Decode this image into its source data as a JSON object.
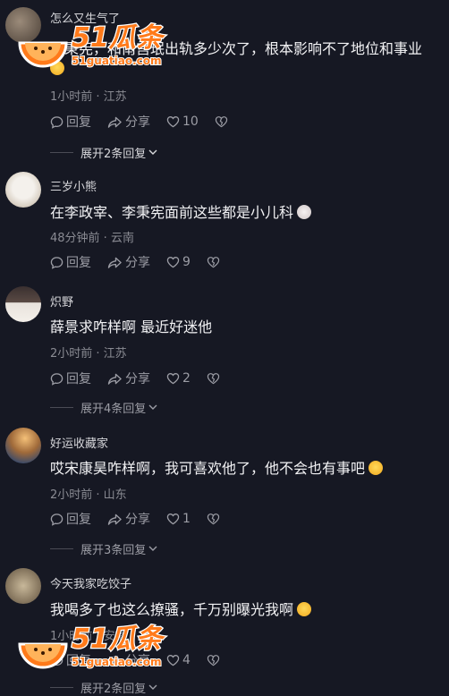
{
  "comments": [
    {
      "username": "怎么又生气了",
      "text": "李秉宪，和南宫珉出轨多少次了，根本影响不了地位和事业",
      "emoji": "grinning-sweat-emoji",
      "time_location": "1小时前 · 江苏",
      "reply_label": "回复",
      "share_label": "分享",
      "likes": "10",
      "expand_label": "展开2条回复"
    },
    {
      "username": "三岁小熊",
      "text": "在李政宰、李秉宪面前这些都是小儿科",
      "emoji": "cat-face-emoji",
      "time_location": "48分钟前 · 云南",
      "reply_label": "回复",
      "share_label": "分享",
      "likes": "9"
    },
    {
      "username": "炽野",
      "text": "薛景求咋样啊 最近好迷他",
      "time_location": "2小时前 · 江苏",
      "reply_label": "回复",
      "share_label": "分享",
      "likes": "2",
      "expand_label": "展开4条回复"
    },
    {
      "username": "好运收藏家",
      "text": "哎宋康昊咋样啊，我可喜欢他了，他不会也有事吧",
      "emoji": "smiling-emoji",
      "time_location": "2小时前 · 山东",
      "reply_label": "回复",
      "share_label": "分享",
      "likes": "1",
      "expand_label": "展开3条回复"
    },
    {
      "username": "今天我家吃饺子",
      "text": "我喝多了也这么撩骚，千万别曝光我啊",
      "emoji": "crying-emoji",
      "time_location": "1小时前 · 安徽",
      "reply_label": "回复",
      "share_label": "分享",
      "likes": "4",
      "expand_label": "展开2条回复"
    }
  ],
  "watermark": {
    "brand": "51瓜条",
    "url": "51guatiao.com"
  },
  "colors": {
    "background": "#161823",
    "text": "#f2f2f4",
    "meta": "#8a8b93",
    "watermark": "#ff7a1a"
  }
}
